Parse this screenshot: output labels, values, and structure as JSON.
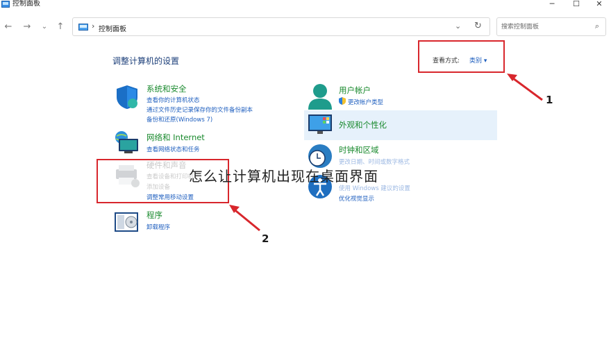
{
  "window": {
    "title": "控制面板",
    "controls": {
      "minimize": "─",
      "maximize": "☐",
      "close": "✕"
    }
  },
  "nav": {
    "back": "←",
    "forward": "→",
    "recent": "⌄",
    "up": "↑"
  },
  "address": {
    "separator": "›",
    "crumb": "控制面板",
    "dropdown": "⌄",
    "refresh": "↻"
  },
  "search": {
    "placeholder": "搜索控制面板",
    "icon": "search-icon"
  },
  "main": {
    "heading": "调整计算机的设置",
    "view_by_label": "查看方式:",
    "view_by_value": "类别 ▾"
  },
  "categories": {
    "system_security": {
      "title": "系统和安全",
      "links": [
        "查看你的计算机状态",
        "通过文件历史记录保存你的文件备份副本",
        "备份和还原(Windows 7)"
      ]
    },
    "network": {
      "title": "网络和 Internet",
      "links": [
        "查看网络状态和任务"
      ]
    },
    "hardware": {
      "title": "硬件和声音",
      "links": [
        "查看设备和打印机",
        "添加设备",
        "调整常用移动设置"
      ]
    },
    "programs": {
      "title": "程序",
      "links": [
        "卸载程序"
      ]
    },
    "user_accounts": {
      "title": "用户帐户",
      "links": [
        "更改帐户类型"
      ]
    },
    "appearance": {
      "title": "外观和个性化"
    },
    "clock_region": {
      "title": "时钟和区域",
      "links": [
        "更改日期、时间或数字格式"
      ]
    },
    "ease_access": {
      "links": [
        "使用 Windows 建议的设置",
        "优化视觉显示"
      ]
    }
  },
  "annotations": {
    "label_1": "1",
    "label_2": "2",
    "color": "#d8262c"
  },
  "watermark": "怎么让计算机出现在桌面界面"
}
